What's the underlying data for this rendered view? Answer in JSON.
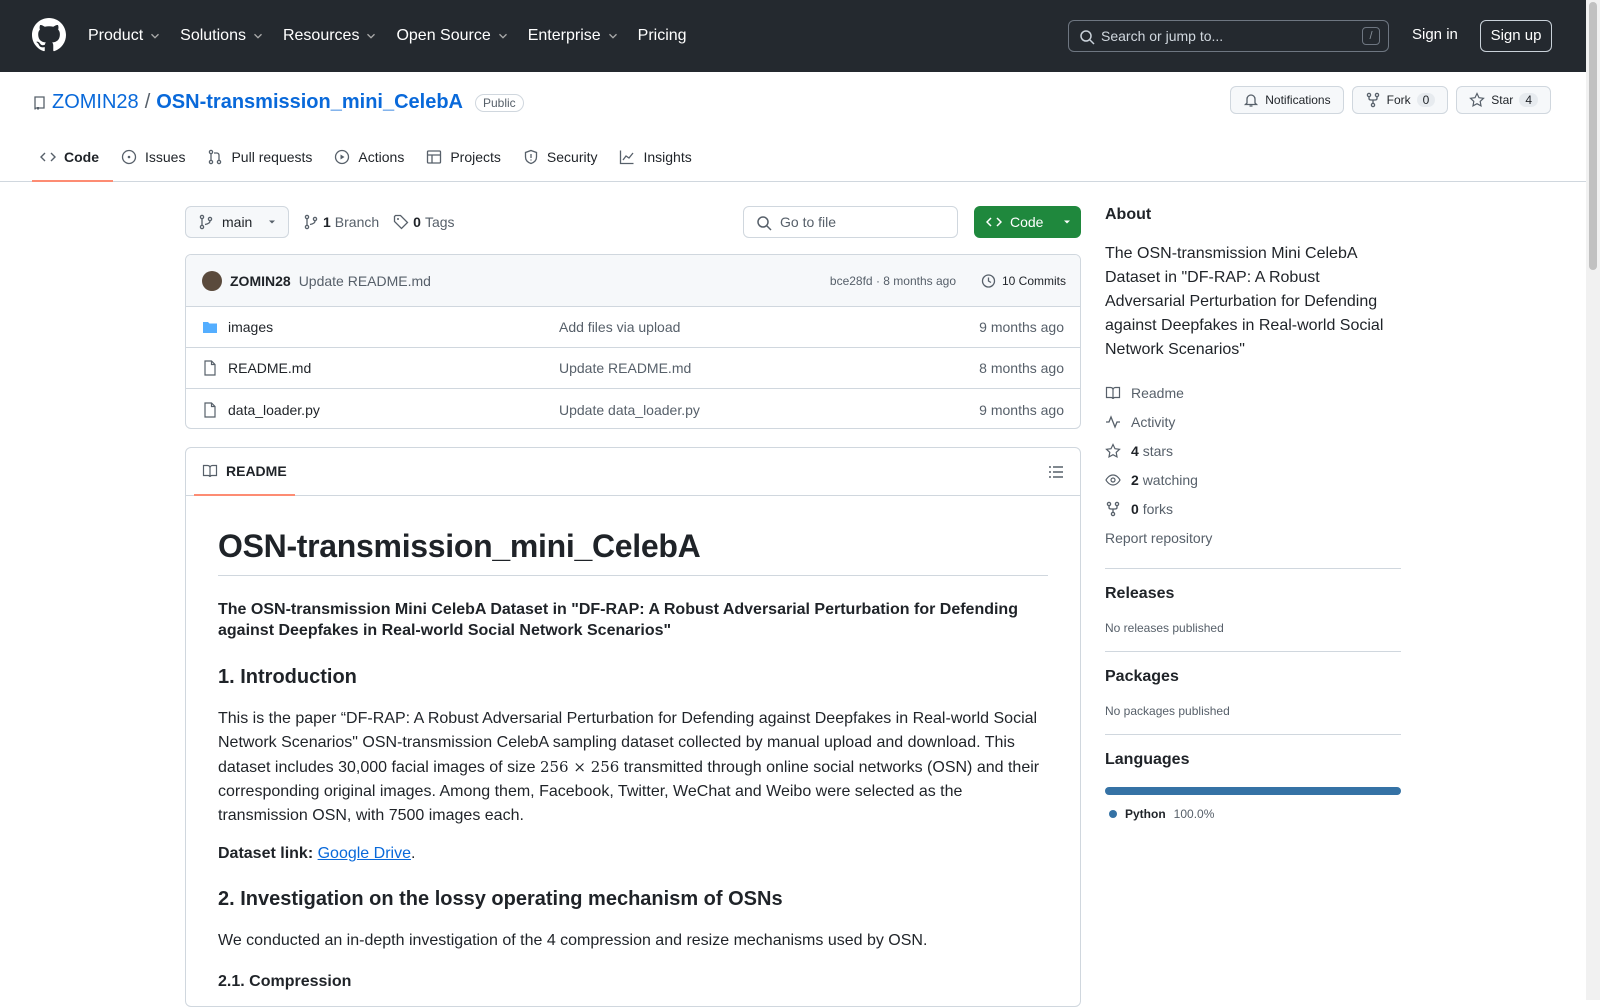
{
  "header": {
    "nav": [
      "Product",
      "Solutions",
      "Resources",
      "Open Source",
      "Enterprise",
      "Pricing"
    ],
    "search_placeholder": "Search or jump to...",
    "search_key": "/",
    "signin": "Sign in",
    "signup": "Sign up"
  },
  "repo": {
    "owner": "ZOMIN28",
    "sep": "/",
    "name": "OSN-transmission_mini_CelebA",
    "visibility": "Public",
    "notifications": "Notifications",
    "fork": "Fork",
    "fork_count": "0",
    "star": "Star",
    "star_count": "4"
  },
  "tabs": [
    "Code",
    "Issues",
    "Pull requests",
    "Actions",
    "Projects",
    "Security",
    "Insights"
  ],
  "toolbar": {
    "branch": "main",
    "branches_count": "1",
    "branches_label": "Branch",
    "tags_count": "0",
    "tags_label": "Tags",
    "goto": "Go to file",
    "code": "Code"
  },
  "commit": {
    "author": "ZOMIN28",
    "message": "Update README.md",
    "meta": "bce28fd · 8 months ago",
    "count": "10 Commits"
  },
  "files": [
    {
      "name": "images",
      "type": "folder",
      "message": "Add files via upload",
      "age": "9 months ago"
    },
    {
      "name": "README.md",
      "type": "file",
      "message": "Update README.md",
      "age": "8 months ago"
    },
    {
      "name": "data_loader.py",
      "type": "file",
      "message": "Update data_loader.py",
      "age": "9 months ago"
    }
  ],
  "readme": {
    "tab": "README",
    "h1": "OSN-transmission_mini_CelebA",
    "subtitle": "The OSN-transmission Mini CelebA Dataset in \"DF-RAP: A Robust Adversarial Perturbation for Defending against Deepfakes in Real-world Social Network Scenarios\"",
    "h2_1": "1. Introduction",
    "intro_a": "This is the paper “DF-RAP: A Robust Adversarial Perturbation for Defending against Deepfakes in Real-world Social Network Scenarios\" OSN-transmission CelebA sampling dataset collected by manual upload and download. This dataset includes 30,000 facial images of size ",
    "intro_math": "256 × 256",
    "intro_b": " transmitted through online social networks (OSN) and their corresponding original images. Among them, Facebook, Twitter, WeChat and Weibo were selected as the transmission OSN, with 7500 images each.",
    "link_label": "Dataset link:",
    "link_text": "Google Drive",
    "link_end": ".",
    "h2_2": "2. Investigation on the lossy operating mechanism of OSNs",
    "investigation": "We conducted an in-depth investigation of the 4 compression and resize mechanisms used by OSN.",
    "h3": "2.1. Compression"
  },
  "sidebar": {
    "about_title": "About",
    "about": "The OSN-transmission Mini CelebA Dataset in \"DF-RAP: A Robust Adversarial Perturbation for Defending against Deepfakes in Real-world Social Network Scenarios\"",
    "readme": "Readme",
    "activity": "Activity",
    "stars_n": "4",
    "stars": "stars",
    "watching_n": "2",
    "watching": "watching",
    "forks_n": "0",
    "forks": "forks",
    "report": "Report repository",
    "releases_title": "Releases",
    "releases": "No releases published",
    "packages_title": "Packages",
    "packages": "No packages published",
    "languages_title": "Languages",
    "lang_name": "Python",
    "lang_pct": "100.0%"
  }
}
